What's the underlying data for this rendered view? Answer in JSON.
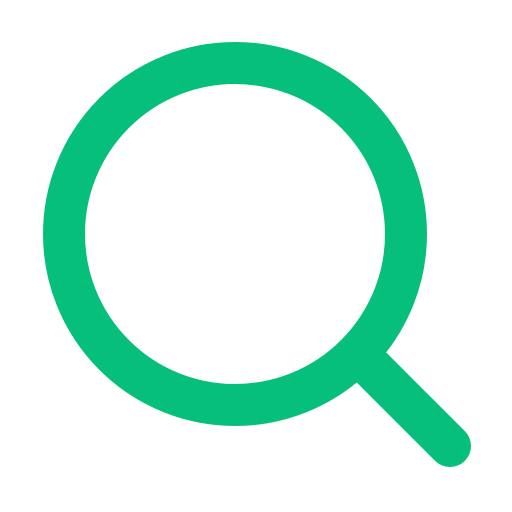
{
  "icon": {
    "name": "search-icon",
    "color": "#05BF7B",
    "background": "#FFFFFF"
  }
}
